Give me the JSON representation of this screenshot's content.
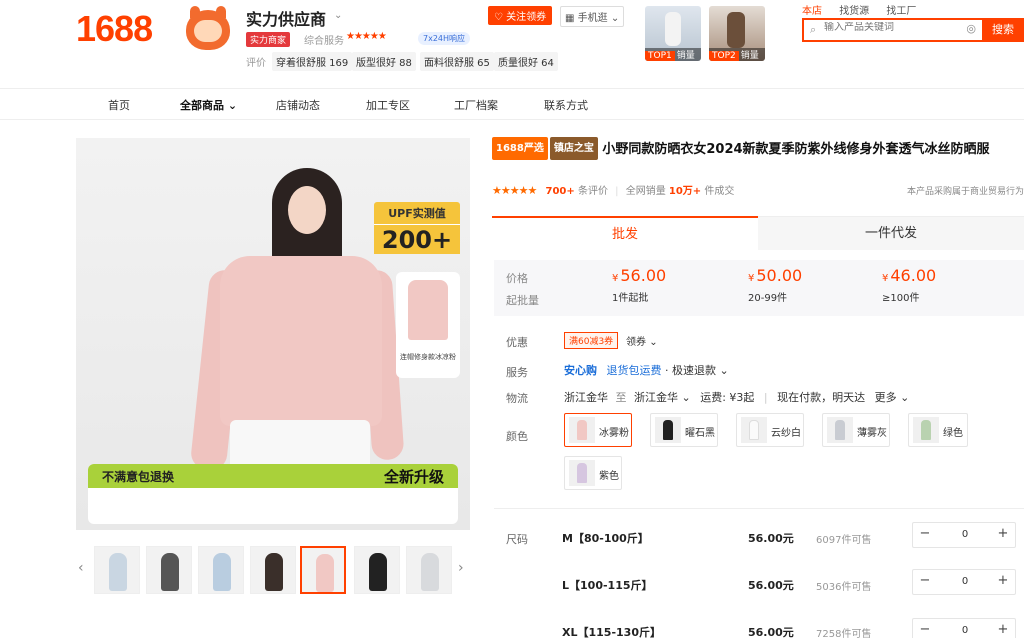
{
  "header": {
    "logo": "1688",
    "shop_name": "实力供应商",
    "badge": "实力商家",
    "svc_label": "综合服务",
    "svc_stars": "★★★★★",
    "svc_pill": "7x24H响应",
    "rate_label": "评价",
    "rates": [
      "穿着很舒服 169",
      "版型很好 88",
      "面料很舒服 65",
      "质量很好 64"
    ],
    "follow": "关注领券",
    "phone": "手机逛",
    "top1": {
      "rank": "TOP1",
      "text": "销量"
    },
    "top2": {
      "rank": "TOP2",
      "text": "销量"
    },
    "links": [
      "本店",
      "找货源",
      "找工厂"
    ],
    "search_placeholder": "输入产品关键词",
    "search_btn": "搜索"
  },
  "nav": [
    "首页",
    "全部商品",
    "店铺动态",
    "加工专区",
    "工厂档案",
    "联系方式"
  ],
  "image": {
    "upf_title": "UPF实测值",
    "upf_value": "200+",
    "mini_caption": "连帽修身款冰凉粉",
    "promo_left": "不满意包退换",
    "promo_right": "全新升级"
  },
  "product": {
    "tag1": "1688严选",
    "tag2": "镇店之宝",
    "title": "小野同款防晒衣女2024新款夏季防紫外线修身外套透气冰丝防晒服",
    "stars": "★★★★★",
    "review_count": "700+",
    "review_label": "条评价",
    "sales_label": "全网销量",
    "sales_value": "10万+",
    "sales_unit": "件成交",
    "notice": "本产品采购属于商业贸易行为"
  },
  "tabs": [
    "批发",
    "一件代发"
  ],
  "price": {
    "label_price": "价格",
    "label_qty": "起批量",
    "currency": "¥",
    "tiers": [
      {
        "price": "56.00",
        "qty": "1件起批"
      },
      {
        "price": "50.00",
        "qty": "20-99件"
      },
      {
        "price": "46.00",
        "qty": "≥100件"
      }
    ]
  },
  "spec": {
    "label_promo": "优惠",
    "coupon": "满60减3券",
    "coupon_more": "领券",
    "label_service": "服务",
    "svc1": "安心购",
    "svc2": "退货包运费",
    "svc3": "· 极速退款",
    "label_ship": "物流",
    "ship_from": "浙江金华",
    "ship_to_word": "至",
    "ship_to": "浙江金华",
    "ship_fee": "运费: ¥3起",
    "ship_time": "现在付款，明天达",
    "ship_more": "更多",
    "label_color": "颜色",
    "colors": [
      {
        "name": "冰雾粉",
        "swatch": "#f1c8c4"
      },
      {
        "name": "曜石黑",
        "swatch": "#222222"
      },
      {
        "name": "云纱白",
        "swatch": "#f4f4f4"
      },
      {
        "name": "薄雾灰",
        "swatch": "#c9ccd2"
      },
      {
        "name": "绿色",
        "swatch": "#b9d2b0"
      },
      {
        "name": "紫色",
        "swatch": "#d6c6e0"
      }
    ],
    "label_size": "尺码",
    "sizes": [
      {
        "name": "M【80-100斤】",
        "price": "56.00元",
        "stock": "6097件可售",
        "qty": "0"
      },
      {
        "name": "L【100-115斤】",
        "price": "56.00元",
        "stock": "5036件可售",
        "qty": "0"
      },
      {
        "name": "XL【115-130斤】",
        "price": "56.00元",
        "stock": "7258件可售",
        "qty": "0"
      }
    ]
  },
  "colors": {
    "accent": "#ff4000",
    "brand_orange": "#ff6a00",
    "link_blue": "#1a6dd8"
  }
}
